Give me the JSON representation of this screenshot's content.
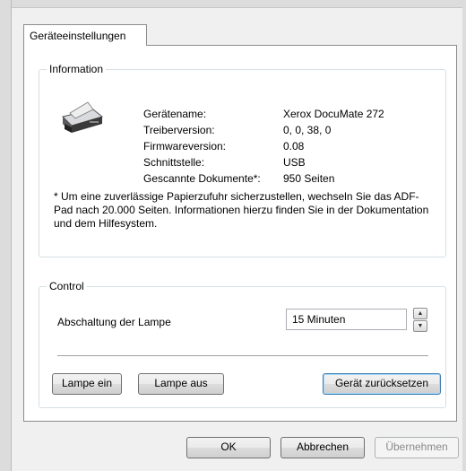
{
  "tab": {
    "label": "Geräteeinstellungen"
  },
  "information": {
    "title": "Information",
    "rows": [
      {
        "label": "Gerätename:",
        "value": "Xerox DocuMate 272"
      },
      {
        "label": "Treiberversion:",
        "value": "0, 0, 38, 0"
      },
      {
        "label": "Firmwareversion:",
        "value": "0.08"
      },
      {
        "label": "Schnittstelle:",
        "value": "USB"
      },
      {
        "label": "Gescannte Dokumente*:",
        "value": "950 Seiten"
      }
    ],
    "note": "* Um eine zuverlässige Papierzufuhr sicherzustellen, wechseln Sie das ADF-Pad nach 20.000 Seiten. Informationen hierzu finden Sie in der Dokumentation und dem Hilfesystem."
  },
  "control": {
    "title": "Control",
    "lamp_label": "Abschaltung der Lampe",
    "lamp_value": "15 Minuten",
    "lamp_on_label": "Lampe ein",
    "lamp_off_label": "Lampe aus",
    "reset_label": "Gerät zurücksetzen"
  },
  "footer": {
    "ok_label": "OK",
    "cancel_label": "Abbrechen",
    "apply_label": "Übernehmen"
  }
}
